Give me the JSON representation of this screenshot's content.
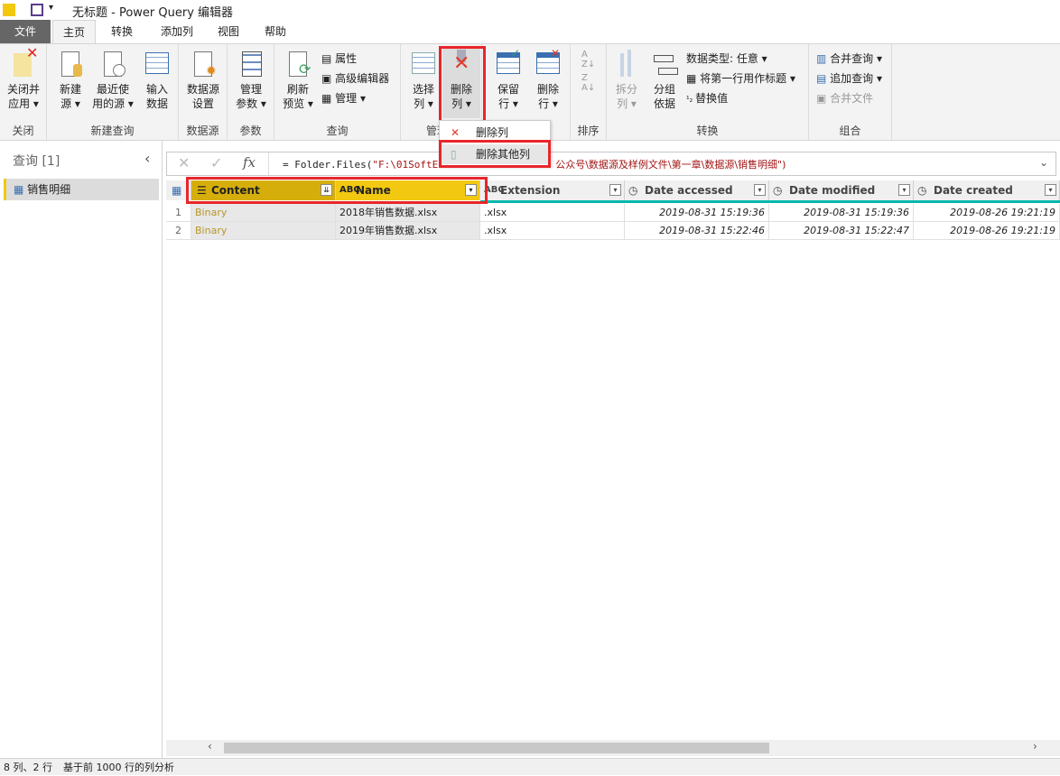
{
  "title": "无标题 - Power Query 编辑器",
  "tabs": [
    "文件",
    "主页",
    "转换",
    "添加列",
    "视图",
    "帮助"
  ],
  "active_tab": "主页",
  "ribbon": {
    "close": {
      "btn": "关闭并\n应用",
      "btn1": "关闭并",
      "btn2": "应用 ▾",
      "label": "关闭"
    },
    "new_query": {
      "b1a": "新建",
      "b1b": "源 ▾",
      "b2a": "最近使",
      "b2b": "用的源 ▾",
      "b3a": "输入",
      "b3b": "数据",
      "label": "新建查询"
    },
    "datasource": {
      "b1a": "数据源",
      "b1b": "设置",
      "label": "数据源"
    },
    "params": {
      "b1a": "管理",
      "b1b": "参数 ▾",
      "label": "参数"
    },
    "query": {
      "b1a": "刷新",
      "b1b": "预览 ▾",
      "s1": "属性",
      "s2": "高级编辑器",
      "s3": "管理 ▾",
      "label": "查询"
    },
    "manage_cols": {
      "b1a": "选择",
      "b1b": "列 ▾",
      "b2a": "删除",
      "b2b": "列 ▾",
      "label": "管理"
    },
    "reduce_rows": {
      "b1a": "保留",
      "b1b": "行 ▾",
      "b2a": "删除",
      "b2b": "行 ▾"
    },
    "sort": {
      "label": "排序"
    },
    "transform": {
      "b1a": "拆分",
      "b1b": "列 ▾",
      "b2a": "分组",
      "b2b": "依据",
      "s1": "数据类型: 任意 ▾",
      "s2": "将第一行用作标题 ▾",
      "s3": "替换值",
      "label": "转换"
    },
    "combine": {
      "s1": "合并查询 ▾",
      "s2": "追加查询 ▾",
      "s3": "合并文件",
      "label": "组合"
    }
  },
  "dropdown_menu": [
    "删除列",
    "删除其他列"
  ],
  "left_pane": {
    "header": "查询 [1]",
    "items": [
      "销售明细"
    ]
  },
  "formula": {
    "prefix": "= Folder.Files(",
    "text": "\"F:\\01SoftE",
    "text2": "公众号\\数据源及样例文件\\第一章\\数据源\\销售明细\")"
  },
  "grid": {
    "columns": [
      {
        "name": "Content",
        "type": "binary"
      },
      {
        "name": "Name",
        "type": "text"
      },
      {
        "name": "Extension",
        "type": "text"
      },
      {
        "name": "Date accessed",
        "type": "datetime"
      },
      {
        "name": "Date modified",
        "type": "datetime"
      },
      {
        "name": "Date created",
        "type": "datetime"
      }
    ],
    "rows": [
      [
        "1",
        "Binary",
        "2018年销售数据.xlsx",
        ".xlsx",
        "2019-08-31 15:19:36",
        "2019-08-31 15:19:36",
        "2019-08-26 19:21:19"
      ],
      [
        "2",
        "Binary",
        "2019年销售数据.xlsx",
        ".xlsx",
        "2019-08-31 15:22:46",
        "2019-08-31 15:22:47",
        "2019-08-26 19:21:19"
      ]
    ]
  },
  "status": {
    "left": "8 列、2 行",
    "right": "基于前 1000 行的列分析"
  },
  "colors": {
    "accent": "#f2c811",
    "highlight": "#e8262b",
    "selected_header": "#d6ae0c",
    "teal": "#01b8aa"
  }
}
